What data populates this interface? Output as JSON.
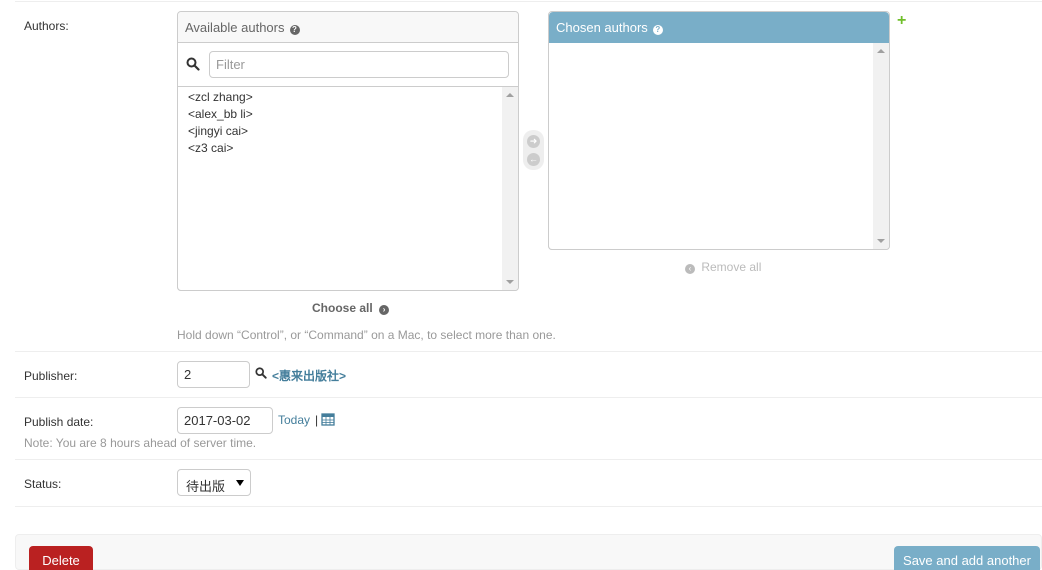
{
  "authors": {
    "label": "Authors:",
    "available": {
      "title": "Available authors",
      "filter_placeholder": "Filter",
      "items": [
        "<zcl zhang>",
        "<alex_bb li>",
        "<jingyi cai>",
        "<z3 cai>"
      ]
    },
    "chosen": {
      "title": "Chosen authors",
      "items": []
    },
    "choose_all_label": "Choose all",
    "remove_all_label": "Remove all",
    "help_text": "Hold down “Control”, or “Command” on a Mac, to select more than one."
  },
  "publisher": {
    "label": "Publisher:",
    "value": "2",
    "related_label": "<惠来出版社>"
  },
  "publish_date": {
    "label": "Publish date:",
    "value": "2017-03-02",
    "today_label": "Today",
    "separator": "|",
    "timezone_note": "Note: You are 8 hours ahead of server time."
  },
  "status": {
    "label": "Status:",
    "selected": "待出版"
  },
  "actions": {
    "delete_label": "Delete",
    "save_add_label": "Save and add another"
  },
  "colors": {
    "accent": "#79aec8",
    "link": "#447e9b",
    "delete": "#ba2121",
    "add": "#70bf2b"
  }
}
